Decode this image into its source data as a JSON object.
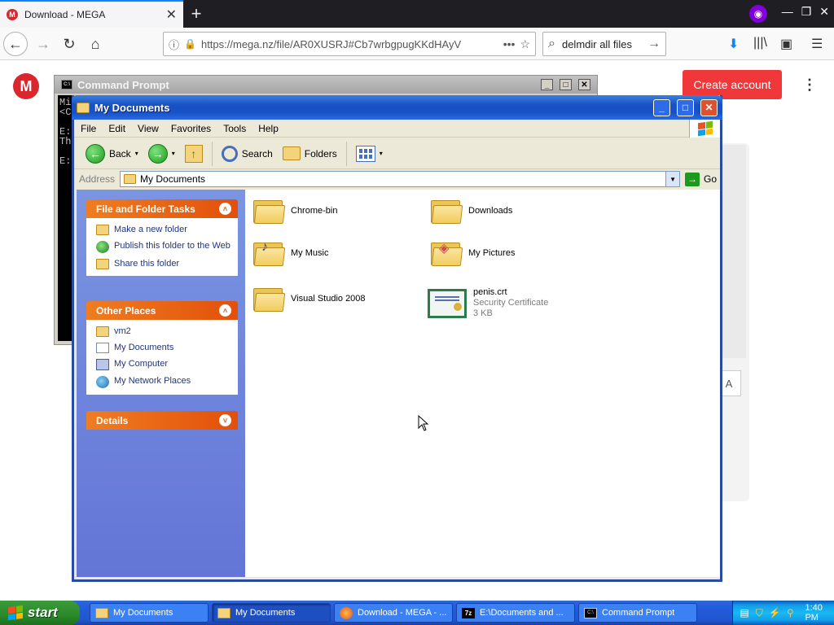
{
  "browser": {
    "tab_title": "Download - MEGA",
    "tab_favicon_letter": "M",
    "tab_close": "✕",
    "new_tab": "+",
    "window_controls": [
      "—",
      "❐",
      "✕"
    ],
    "url": "https://mega.nz/file/AR0XUSRJ#Cb7wrbgpugKKdHAyV",
    "url_info": "ⓘ",
    "url_lock": "🔒",
    "search_text": "delmdir all files",
    "icons": {
      "back": "←",
      "forward": "→",
      "reload": "↻",
      "home": "⌂",
      "page_actions": "•••",
      "bookmark_star": "☆",
      "search": "⌕",
      "search_go": "→",
      "downloads": "⬇",
      "library": "|||\\",
      "sidebar": "▣",
      "menu": "☰"
    }
  },
  "mega": {
    "logo_letter": "M",
    "create_account": "Create account",
    "kebab": "⋮",
    "side_button": "A"
  },
  "cmd": {
    "title": "Command Prompt",
    "icon_text": "C:\\",
    "controls": [
      "_",
      "□",
      "✕"
    ],
    "lines": [
      "Mi",
      "<C",
      "",
      "E:",
      "Th",
      "",
      "E:"
    ]
  },
  "explorer": {
    "title": "My Documents",
    "controls": [
      "_",
      "□",
      "✕"
    ],
    "menu": [
      "File",
      "Edit",
      "View",
      "Favorites",
      "Tools",
      "Help"
    ],
    "toolbar": {
      "back": "Back",
      "search": "Search",
      "folders": "Folders",
      "dropdown": "▾"
    },
    "address": {
      "label": "Address",
      "value": "My Documents",
      "go": "Go"
    },
    "taskpane": {
      "file_tasks": {
        "title": "File and Folder Tasks",
        "items": [
          "Make a new folder",
          "Publish this folder to the Web",
          "Share this folder"
        ]
      },
      "other_places": {
        "title": "Other Places",
        "items": [
          "vm2",
          "My Documents",
          "My Computer",
          "My Network Places"
        ]
      },
      "details": {
        "title": "Details"
      },
      "chevron_up": "˄",
      "chevron_down": "˅"
    },
    "files": [
      {
        "name": "Chrome-bin",
        "kind": "folder"
      },
      {
        "name": "Downloads",
        "kind": "folder"
      },
      {
        "name": "My Music",
        "kind": "music-folder"
      },
      {
        "name": "My Pictures",
        "kind": "pictures-folder"
      },
      {
        "name": "Visual Studio 2008",
        "kind": "folder"
      },
      {
        "name": "penis.crt",
        "kind": "certificate",
        "type": "Security Certificate",
        "size": "3 KB"
      }
    ]
  },
  "taskbar": {
    "start": "start",
    "buttons": [
      {
        "label": "My Documents",
        "icon": "folder-icon",
        "active": false
      },
      {
        "label": "My Documents",
        "icon": "folder-icon",
        "active": true
      },
      {
        "label": "Download - MEGA - ...",
        "icon": "firefox-icon",
        "active": false
      },
      {
        "label": "E:\\Documents and ...",
        "icon": "7zip-icon",
        "active": false
      },
      {
        "label": "Command Prompt",
        "icon": "cmd-icon",
        "active": false
      }
    ],
    "tray": {
      "time": "1:40 PM"
    }
  }
}
